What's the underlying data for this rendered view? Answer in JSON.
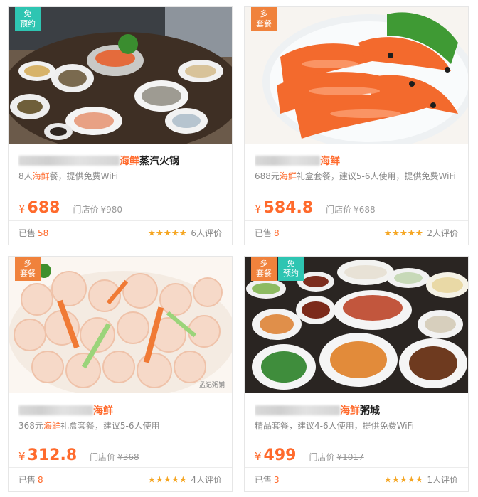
{
  "cards": [
    {
      "badges": [
        {
          "l1": "免",
          "l2": "预约",
          "color": "teal"
        }
      ],
      "title_suffix": "蒸汽火锅",
      "title_hl": "海鲜",
      "desc_pre": "8人",
      "desc_hl": "海鲜",
      "desc_post": "餐，提供免费WiFi",
      "currency": "¥",
      "price": "688",
      "orig_label": "门店价",
      "orig": "¥980",
      "sold_label": "已售",
      "sold": "58",
      "reviews": "6人评价",
      "photo": "seafood-banquet-table"
    },
    {
      "badges": [
        {
          "l1": "多",
          "l2": "套餐",
          "color": "orange"
        }
      ],
      "title_suffix": "",
      "title_hl": "海鲜",
      "desc_pre": "688元",
      "desc_hl": "海鲜",
      "desc_post": "礼盒套餐，建议5-6人使用，提供免费WiFi",
      "currency": "¥",
      "price": "584.8",
      "orig_label": "门店价",
      "orig": "¥688",
      "sold_label": "已售",
      "sold": "8",
      "reviews": "2人评价",
      "photo": "boiled-shrimp-bowl"
    },
    {
      "badges": [
        {
          "l1": "多",
          "l2": "套餐",
          "color": "orange"
        }
      ],
      "title_suffix": "",
      "title_hl": "海鲜",
      "desc_pre": "368元",
      "desc_hl": "海鲜",
      "desc_post": "礼盒套餐，建议5-6人使用",
      "currency": "¥",
      "price": "312.8",
      "orig_label": "门店价",
      "orig": "¥368",
      "sold_label": "已售",
      "sold": "8",
      "reviews": "4人评价",
      "photo": "stir-fried-shrimp",
      "watermark": "孟记粥铺"
    },
    {
      "badges": [
        {
          "l1": "多",
          "l2": "套餐",
          "color": "orange"
        },
        {
          "l1": "免",
          "l2": "预约",
          "color": "teal"
        }
      ],
      "title_suffix": "粥城",
      "title_hl": "海鲜",
      "desc_pre": "",
      "desc_hl": "",
      "desc_post": "精品套餐，建议4-6人使用，提供免费WiFi",
      "currency": "¥",
      "price": "499",
      "orig_label": "门店价",
      "orig": "¥1017",
      "sold_label": "已售",
      "sold": "3",
      "reviews": "1人评价",
      "photo": "dishes-table-spread"
    }
  ],
  "colors": {
    "accent": "#ff6a2c",
    "badge_orange": "#f0823c",
    "badge_teal": "#2ec5b2",
    "star": "#f5a623"
  }
}
